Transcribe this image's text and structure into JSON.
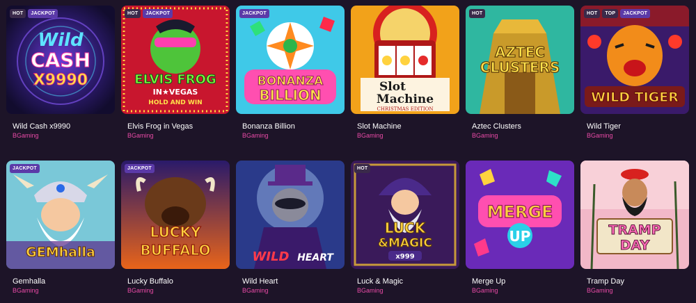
{
  "games": [
    {
      "title": "Wild Cash x9990",
      "provider": "BGaming",
      "badges": [
        "HOT",
        "JACKPOT"
      ],
      "logo": [
        "Wild",
        "CASH",
        "X9990"
      ]
    },
    {
      "title": "Elvis Frog in Vegas",
      "provider": "BGaming",
      "badges": [
        "HOT",
        "JACKPOT"
      ],
      "logo": [
        "ELVIS FROG",
        "IN★VEGAS",
        "HOLD AND WIN"
      ]
    },
    {
      "title": "Bonanza Billion",
      "provider": "BGaming",
      "badges": [
        "JACKPOT"
      ],
      "logo": [
        "BONANZA",
        "BILLION"
      ]
    },
    {
      "title": "Slot Machine",
      "provider": "BGaming",
      "badges": [],
      "logo": [
        "Slot",
        "Machine",
        "CHRISTMAS EDITION"
      ]
    },
    {
      "title": "Aztec Clusters",
      "provider": "BGaming",
      "badges": [
        "HOT"
      ],
      "logo": [
        "AZTEC",
        "CLUSTERS"
      ]
    },
    {
      "title": "Wild Tiger",
      "provider": "BGaming",
      "badges": [
        "HOT",
        "TOP",
        "JACKPOT"
      ],
      "logo": [
        "WILD TIGER"
      ]
    },
    {
      "title": "Gemhalla",
      "provider": "BGaming",
      "badges": [
        "JACKPOT"
      ],
      "logo": [
        "GEMhalla"
      ]
    },
    {
      "title": "Lucky Buffalo",
      "provider": "BGaming",
      "badges": [
        "JACKPOT"
      ],
      "logo": [
        "LUCKY",
        "BUFFALO"
      ]
    },
    {
      "title": "Wild Heart",
      "provider": "BGaming",
      "badges": [],
      "logo": [
        "WILD",
        "HEART"
      ]
    },
    {
      "title": "Luck & Magic",
      "provider": "BGaming",
      "badges": [
        "HOT"
      ],
      "logo": [
        "LUCK",
        "&MAGIC",
        "x999"
      ]
    },
    {
      "title": "Merge Up",
      "provider": "BGaming",
      "badges": [],
      "logo": [
        "MERGE",
        "UP"
      ]
    },
    {
      "title": "Tramp Day",
      "provider": "BGaming",
      "badges": [],
      "logo": [
        "TRAMP",
        "DAY"
      ]
    }
  ]
}
